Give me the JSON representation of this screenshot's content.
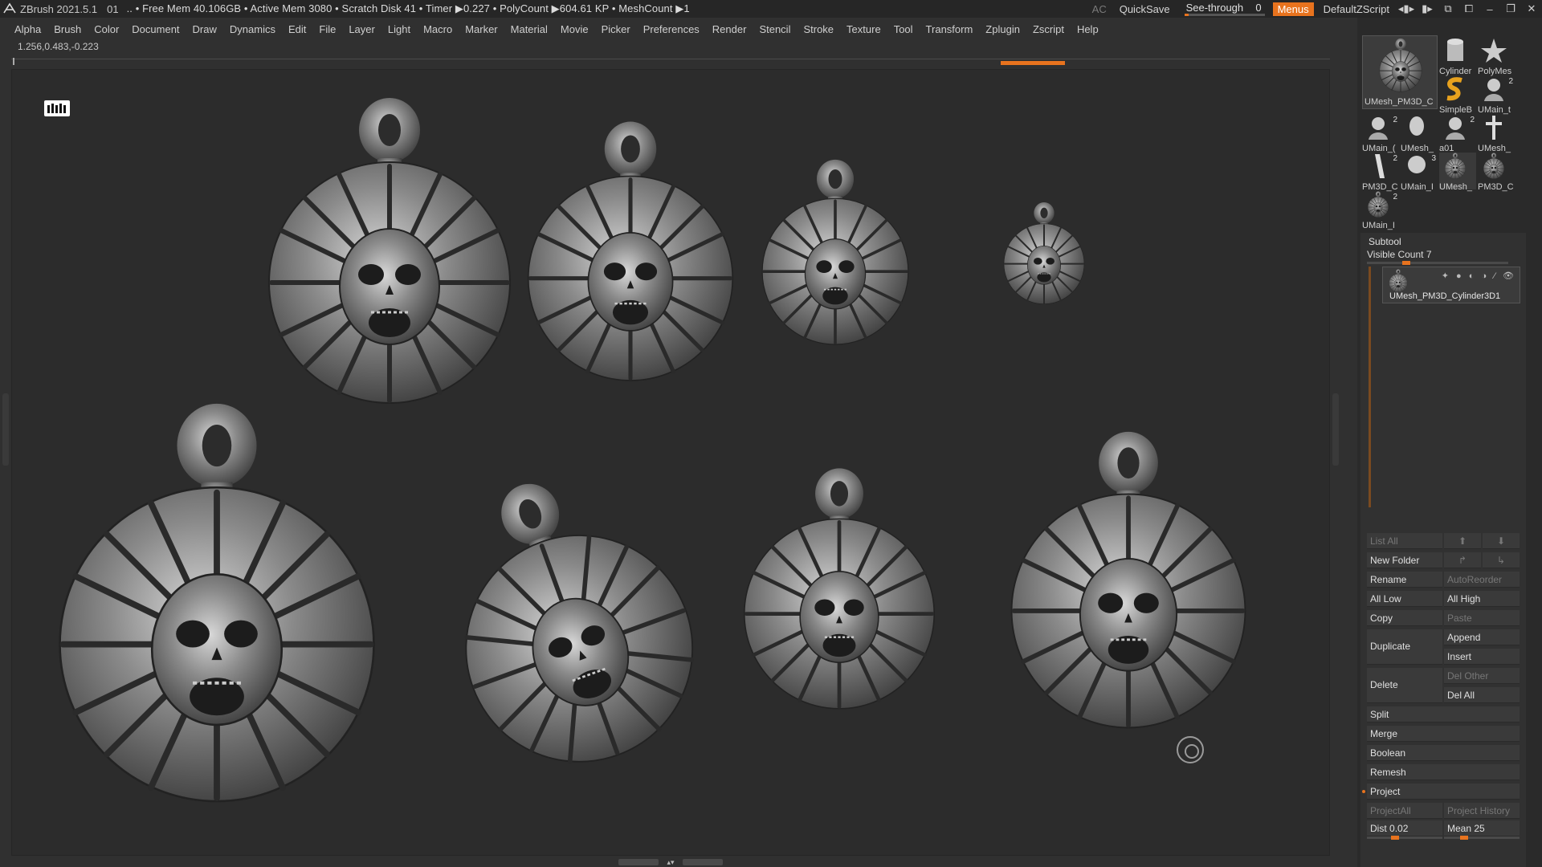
{
  "status": {
    "app_version": "ZBrush 2021.5.1",
    "doc": "01",
    "info": ".. • Free Mem 40.106GB • Active Mem 3080 • Scratch Disk 41 • Timer ▶0.227 • PolyCount ▶604.61 KP • MeshCount ▶1",
    "ac": "AC",
    "quicksave": "QuickSave",
    "see_through_label": "See-through",
    "see_through_value": "0",
    "see_through_level": 0.05,
    "menus": "Menus",
    "script": "DefaultZScript"
  },
  "menu": [
    "Alpha",
    "Brush",
    "Color",
    "Document",
    "Draw",
    "Dynamics",
    "Edit",
    "File",
    "Layer",
    "Light",
    "Macro",
    "Marker",
    "Material",
    "Movie",
    "Picker",
    "Preferences",
    "Render",
    "Stencil",
    "Stroke",
    "Texture",
    "Tool",
    "Transform",
    "Zplugin",
    "Zscript",
    "Help"
  ],
  "coords": "1.256,0.483,-0.223",
  "tool_palette": {
    "main_label": "UMesh_PM3D_C",
    "thumbs": [
      {
        "label": "Cylinder",
        "count": ""
      },
      {
        "label": "PolyMes",
        "count": ""
      },
      {
        "label": "SimpleB",
        "count": ""
      },
      {
        "label": "UMain_t",
        "count": "2"
      },
      {
        "label": "UMain_(",
        "count": "2"
      },
      {
        "label": "UMesh_",
        "count": ""
      },
      {
        "label": "a01",
        "count": "2"
      },
      {
        "label": "UMesh_",
        "count": ""
      },
      {
        "label": "PM3D_C",
        "count": "2"
      },
      {
        "label": "UMain_I",
        "count": "3"
      },
      {
        "label": "UMesh_",
        "count": ""
      },
      {
        "label": "PM3D_C",
        "count": ""
      },
      {
        "label": "UMain_I",
        "count": "2"
      }
    ]
  },
  "subtool": {
    "title": "Subtool",
    "visible_count": "Visible Count 7",
    "item_name": "UMesh_PM3D_Cylinder3D1",
    "list_all": "List All",
    "new_folder": "New Folder",
    "rename": "Rename",
    "auto_reorder": "AutoReorder",
    "all_low": "All Low",
    "all_high": "All High",
    "copy": "Copy",
    "paste": "Paste",
    "duplicate": "Duplicate",
    "append": "Append",
    "insert": "Insert",
    "delete": "Delete",
    "del_other": "Del Other",
    "del_all": "Del All",
    "split": "Split",
    "merge": "Merge",
    "boolean": "Boolean",
    "remesh": "Remesh",
    "project": "Project",
    "project_all": "ProjectAll",
    "project_history": "Project History",
    "dist_label": "Dist",
    "dist_value": "0.02",
    "mean_label": "Mean",
    "mean_value": "25"
  },
  "colors": {
    "accent": "#e8731e",
    "bg": "#2c2c2c",
    "panel": "#313131"
  }
}
